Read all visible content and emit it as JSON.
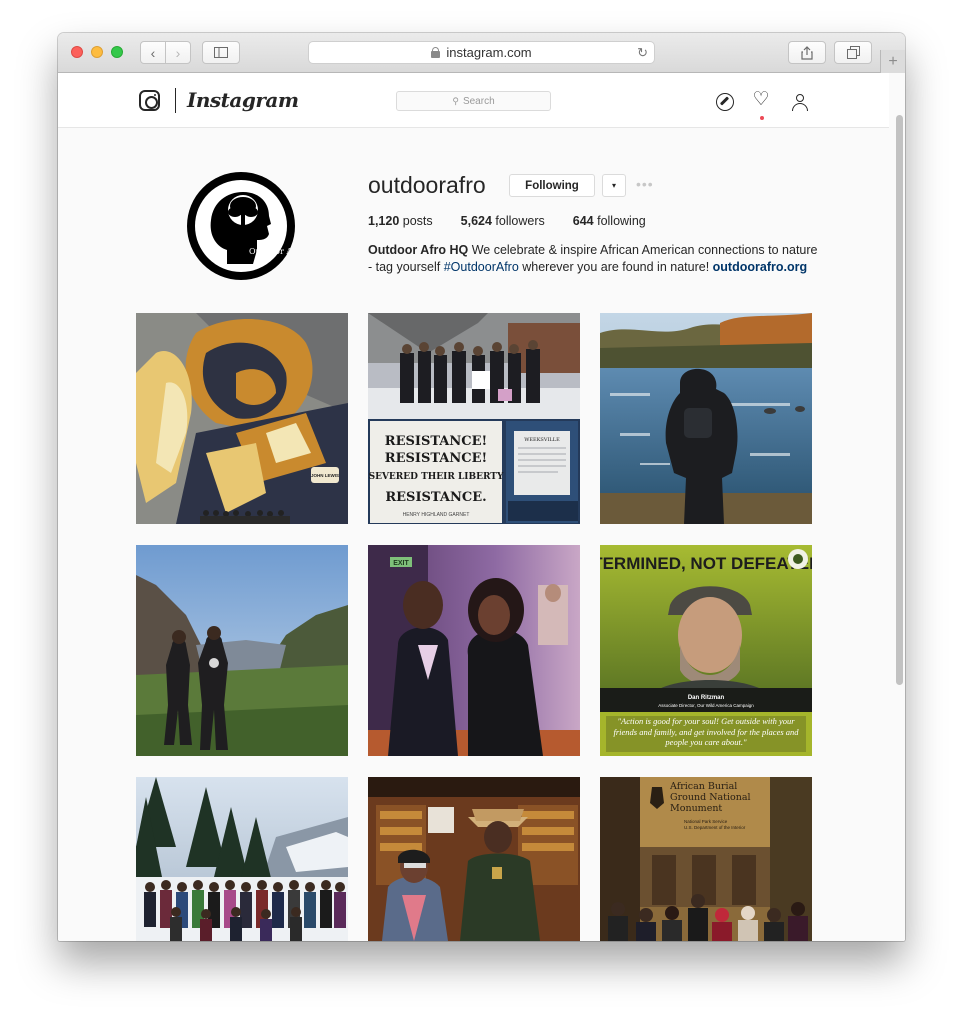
{
  "browser": {
    "url": "instagram.com",
    "new_tab_label": "+"
  },
  "header": {
    "wordmark": "Instagram",
    "search_placeholder": "Search",
    "notification_color": "#ed4956"
  },
  "profile": {
    "username": "outdoorafro",
    "following_label": "Following",
    "dropdown_glyph": "▾",
    "more_glyph": "•••",
    "avatar_text": "OutDoor Afro",
    "stats": [
      {
        "value": "1,120",
        "label": "posts"
      },
      {
        "value": "5,624",
        "label": "followers"
      },
      {
        "value": "644",
        "label": "following"
      }
    ],
    "bio_name": "Outdoor Afro HQ",
    "bio_text_1": " We celebrate & inspire African American connections to nature - tag yourself ",
    "bio_hashtag": "#OutdoorAfro",
    "bio_text_2": " wherever you are found in nature! ",
    "bio_link": "outdoorafro.org"
  },
  "posts": [
    {
      "id": "mural",
      "caption": "",
      "badge": "JOHN LEWIS"
    },
    {
      "id": "resistance",
      "caption": "RESISTANCE! RESISTANCE! SEVERED THEIR LIBERTY RESISTANCE.",
      "sub": "HENRY HIGHLAND GARNET",
      "sign": "WEEKSVILLE"
    },
    {
      "id": "river",
      "caption": ""
    },
    {
      "id": "hikers",
      "caption": ""
    },
    {
      "id": "couple",
      "caption": "EXIT"
    },
    {
      "id": "determined",
      "title": "DETERMINED, NOT DEFEATED",
      "person": "Dan Ritzman",
      "role": "Associate Director, Our Wild America Campaign",
      "quote": "\"Action is good for your soul! Get outside with your friends and family, and get involved for the places and people you care about.\""
    },
    {
      "id": "snow",
      "caption": ""
    },
    {
      "id": "ranger",
      "caption": ""
    },
    {
      "id": "burial",
      "title": "African Burial Ground National Monument",
      "sub1": "National Park Service",
      "sub2": "U.S. Department of the Interior"
    }
  ]
}
